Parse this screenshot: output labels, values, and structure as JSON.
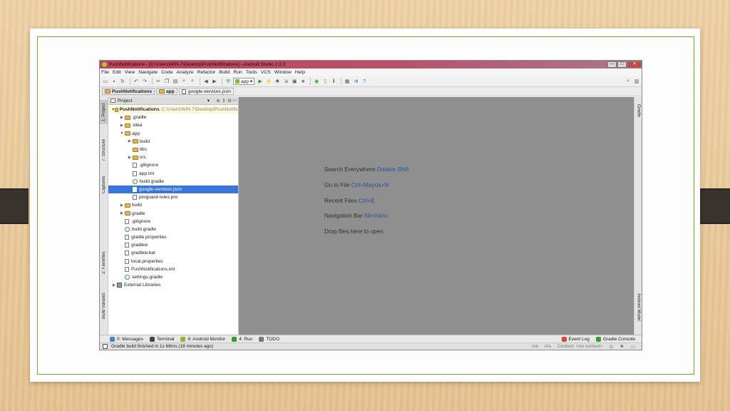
{
  "window": {
    "title": "PushNotifications - [C:\\Users\\WIN-7\\Desktop\\PushNotifications] - Android Studio 2.3.3",
    "minimize": "—",
    "maximize": "□",
    "close": "✕"
  },
  "menu": [
    "File",
    "Edit",
    "View",
    "Navigate",
    "Code",
    "Analyze",
    "Refactor",
    "Build",
    "Run",
    "Tools",
    "VCS",
    "Window",
    "Help"
  ],
  "toolbar": {
    "run_config": "app"
  },
  "breadcrumb": [
    "PushNotifications",
    "app",
    "google-services.json"
  ],
  "left_tabs": [
    "1: Project",
    "7: Structure",
    "Captures",
    "2: Favorites",
    "Build Variants"
  ],
  "right_tabs": [
    "Gradle",
    "Android Model"
  ],
  "project_panel": {
    "view_mode": "Project",
    "tree": [
      {
        "label": "PushNotifications",
        "path": "C:\\Users\\WIN-7\\Desktop\\PushNotific",
        "depth": 0,
        "arrow": "▼",
        "icon": "folder",
        "root": true
      },
      {
        "label": ".gradle",
        "depth": 1,
        "arrow": "▶",
        "icon": "folder"
      },
      {
        "label": ".idea",
        "depth": 1,
        "arrow": "▶",
        "icon": "folder"
      },
      {
        "label": "app",
        "depth": 1,
        "arrow": "▼",
        "icon": "folder"
      },
      {
        "label": "build",
        "depth": 2,
        "arrow": "▶",
        "icon": "folder"
      },
      {
        "label": "libs",
        "depth": 2,
        "arrow": "",
        "icon": "folder"
      },
      {
        "label": "src",
        "depth": 2,
        "arrow": "▶",
        "icon": "folder"
      },
      {
        "label": ".gitignore",
        "depth": 2,
        "arrow": "",
        "icon": "file"
      },
      {
        "label": "app.iml",
        "depth": 2,
        "arrow": "",
        "icon": "file"
      },
      {
        "label": "build.gradle",
        "depth": 2,
        "arrow": "",
        "icon": "gradle"
      },
      {
        "label": "google-services.json",
        "depth": 2,
        "arrow": "",
        "icon": "json",
        "selected": true
      },
      {
        "label": "proguard-rules.pro",
        "depth": 2,
        "arrow": "",
        "icon": "file"
      },
      {
        "label": "build",
        "depth": 1,
        "arrow": "▶",
        "icon": "folder"
      },
      {
        "label": "gradle",
        "depth": 1,
        "arrow": "▶",
        "icon": "folder"
      },
      {
        "label": ".gitignore",
        "depth": 1,
        "arrow": "",
        "icon": "file"
      },
      {
        "label": "build.gradle",
        "depth": 1,
        "arrow": "",
        "icon": "gradle"
      },
      {
        "label": "gradle.properties",
        "depth": 1,
        "arrow": "",
        "icon": "file"
      },
      {
        "label": "gradlew",
        "depth": 1,
        "arrow": "",
        "icon": "file"
      },
      {
        "label": "gradlew.bat",
        "depth": 1,
        "arrow": "",
        "icon": "file"
      },
      {
        "label": "local.properties",
        "depth": 1,
        "arrow": "",
        "icon": "file"
      },
      {
        "label": "PushNotifications.iml",
        "depth": 1,
        "arrow": "",
        "icon": "file"
      },
      {
        "label": "settings.gradle",
        "depth": 1,
        "arrow": "",
        "icon": "gradle"
      },
      {
        "label": "External Libraries",
        "depth": 0,
        "arrow": "▶",
        "icon": "library"
      }
    ]
  },
  "editor_hints": [
    {
      "text": "Search Everywhere",
      "key": "Double Shift"
    },
    {
      "text": "Go to File",
      "key": "Ctrl+Mayús+N"
    },
    {
      "text": "Recent Files",
      "key": "Ctrl+E"
    },
    {
      "text": "Navigation Bar",
      "key": "Alt+Inicio"
    },
    {
      "text": "Drop files here to open",
      "key": ""
    }
  ],
  "bottom_tabs": [
    {
      "label": "0: Messages",
      "icon": "messages-icon",
      "color": "#5b7fb0"
    },
    {
      "label": "Terminal",
      "icon": "terminal-icon",
      "color": "#444444"
    },
    {
      "label": "6: Android Monitor",
      "icon": "android-monitor-icon",
      "color": "#8cb83a"
    },
    {
      "label": "4: Run",
      "icon": "run-icon",
      "color": "#3a9a3a"
    },
    {
      "label": "TODO",
      "icon": "todo-icon",
      "color": "#777777"
    }
  ],
  "bottom_right_tabs": [
    {
      "label": "Event Log",
      "icon": "event-log-icon",
      "color": "#d9453a"
    },
    {
      "label": "Gradle Console",
      "icon": "gradle-console-icon",
      "color": "#3a9a3a"
    }
  ],
  "status": {
    "message": "Gradle build finished in 1s 68ms (18 minutes ago)",
    "line_col": "n/a",
    "encoding": "n/a",
    "context": "Context: <no context>"
  }
}
